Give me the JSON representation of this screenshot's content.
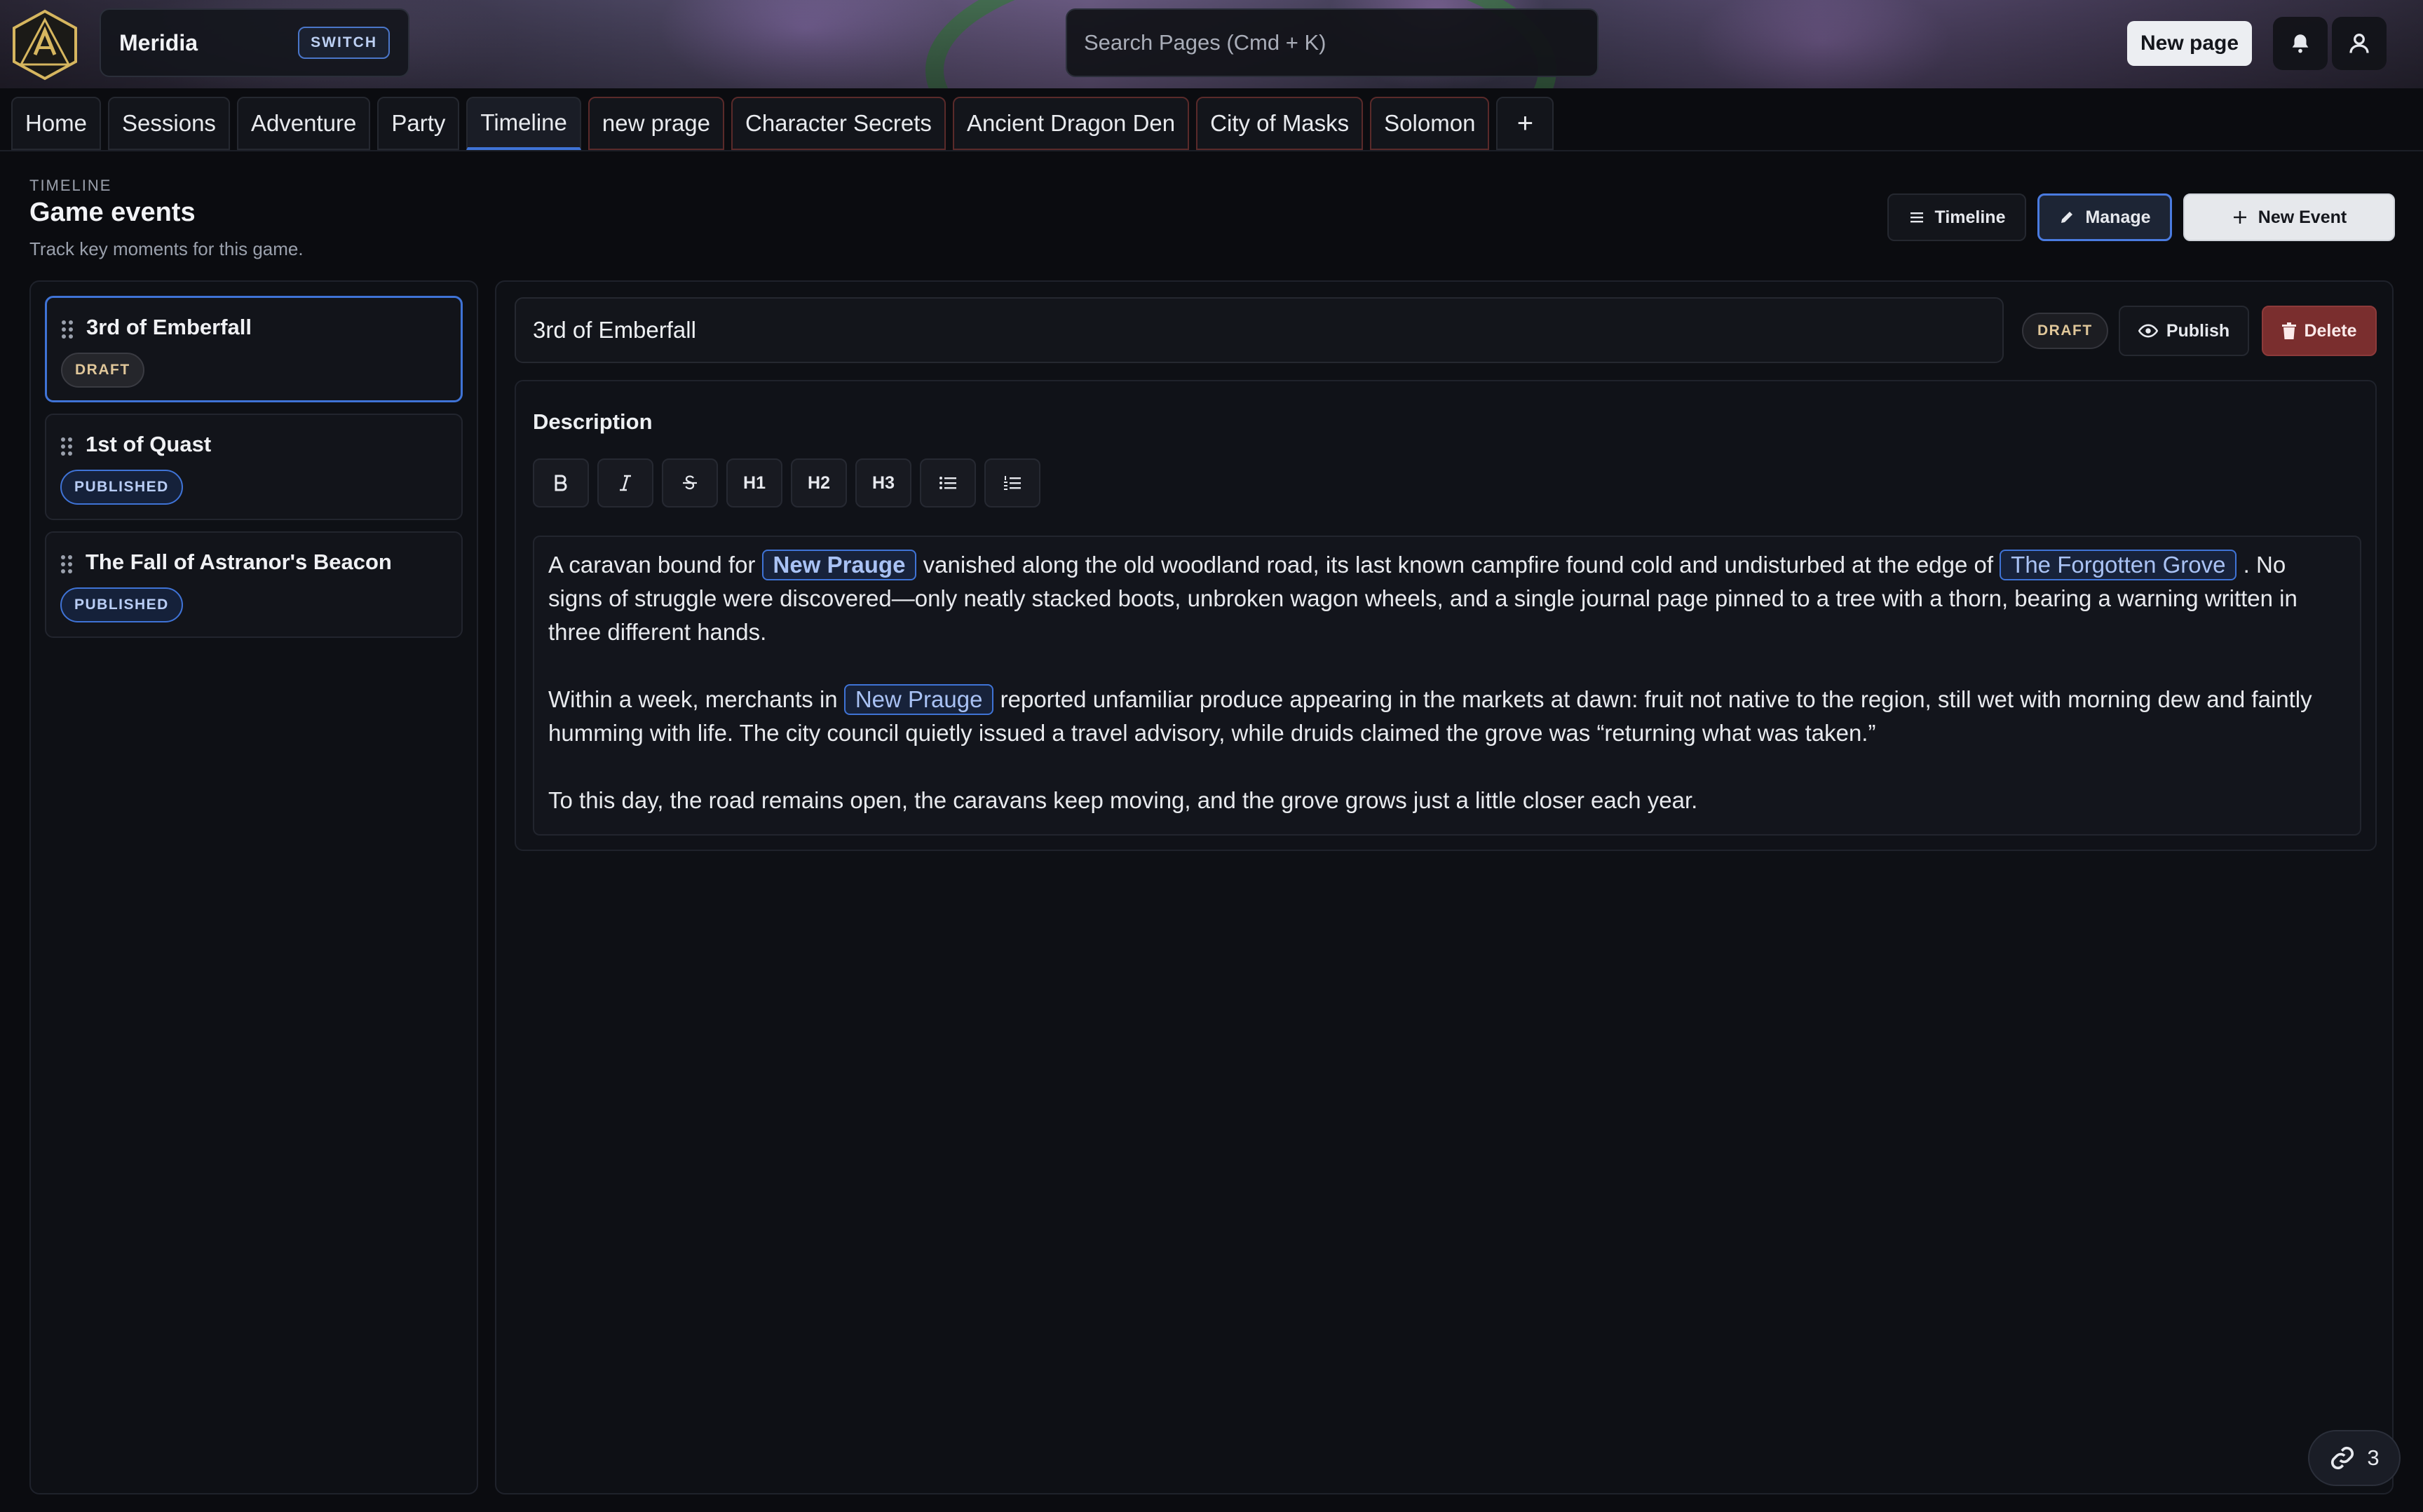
{
  "campaign": {
    "name": "Meridia",
    "switch_label": "SWITCH"
  },
  "search": {
    "placeholder": "Search Pages (Cmd + K)"
  },
  "topbar": {
    "new_page_label": "New page"
  },
  "tabs": [
    {
      "label": "Home"
    },
    {
      "label": "Sessions"
    },
    {
      "label": "Adventure"
    },
    {
      "label": "Party"
    },
    {
      "label": "Timeline"
    },
    {
      "label": "new prage"
    },
    {
      "label": "Character Secrets"
    },
    {
      "label": "Ancient Dragon Den"
    },
    {
      "label": "City of Masks"
    },
    {
      "label": "Solomon"
    }
  ],
  "tab_add_label": "+",
  "header": {
    "eyebrow": "TIMELINE",
    "title": "Game events",
    "subtitle": "Track key moments for this game.",
    "timeline_btn": "Timeline",
    "manage_btn": "Manage",
    "new_event_btn": "New Event"
  },
  "events": [
    {
      "title": "3rd of Emberfall",
      "status": "DRAFT"
    },
    {
      "title": "1st of Quast",
      "status": "PUBLISHED"
    },
    {
      "title": "The Fall of Astranor's Beacon",
      "status": "PUBLISHED"
    }
  ],
  "editor": {
    "title_value": "3rd of Emberfall",
    "status": "DRAFT",
    "publish_label": "Publish",
    "delete_label": "Delete",
    "description_label": "Description",
    "toolbar": {
      "h1": "H1",
      "h2": "H2",
      "h3": "H3"
    },
    "p1": {
      "a": "A caravan bound for ",
      "m1": "New Prauge",
      "b": " vanished along the old woodland road, its last known campfire found cold and undisturbed at the edge of ",
      "m2": "The Forgotten Grove",
      "c": " . No signs of struggle were discovered—only neatly stacked boots, unbroken wagon wheels, and a single journal page pinned to a tree with a thorn, bearing a warning written in three different hands."
    },
    "p2": {
      "a": "Within a week, merchants in ",
      "m1": "New Prauge",
      "b": " reported unfamiliar produce appearing in the markets at dawn: fruit not native to the region, still wet with morning dew and faintly humming with life. The city council quietly issued a travel advisory, while druids claimed the grove was “returning what was taken.”"
    },
    "p3": "To this day, the road remains open, the caravans keep moving, and the grove grows just a little closer each year."
  },
  "links_count": "3",
  "colors": {
    "accent": "#3f73d6",
    "danger": "#7a2e2e",
    "draft": "#e0c79a"
  }
}
